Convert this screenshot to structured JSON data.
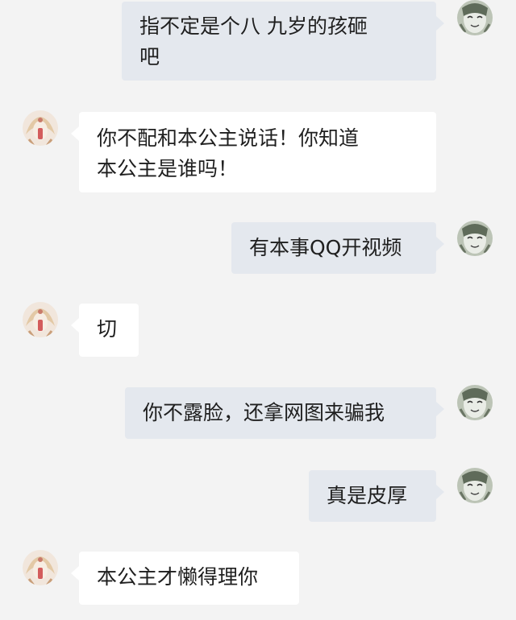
{
  "messages": [
    {
      "side": "me",
      "text": "指不定是个八 九岁的孩砸\n吧",
      "avatar": "fanart-face-avatar"
    },
    {
      "side": "them",
      "text": "你不配和本公主说话！你知道\n本公主是谁吗！",
      "avatar": "princess-portrait-avatar"
    },
    {
      "side": "me",
      "text": "有本事QQ开视频",
      "avatar": "fanart-face-avatar"
    },
    {
      "side": "them",
      "text": "切",
      "avatar": "princess-portrait-avatar"
    },
    {
      "side": "me",
      "text": "你不露脸，还拿网图来骗我",
      "avatar": "fanart-face-avatar"
    },
    {
      "side": "me",
      "text": "真是皮厚",
      "avatar": "fanart-face-avatar"
    },
    {
      "side": "them",
      "text": "本公主才懒得理你",
      "avatar": "princess-portrait-avatar"
    }
  ],
  "colors": {
    "background": "#f3f3f3",
    "my_bubble": "#e4e8ee",
    "their_bubble": "#ffffff",
    "text": "#1f1f1f"
  }
}
